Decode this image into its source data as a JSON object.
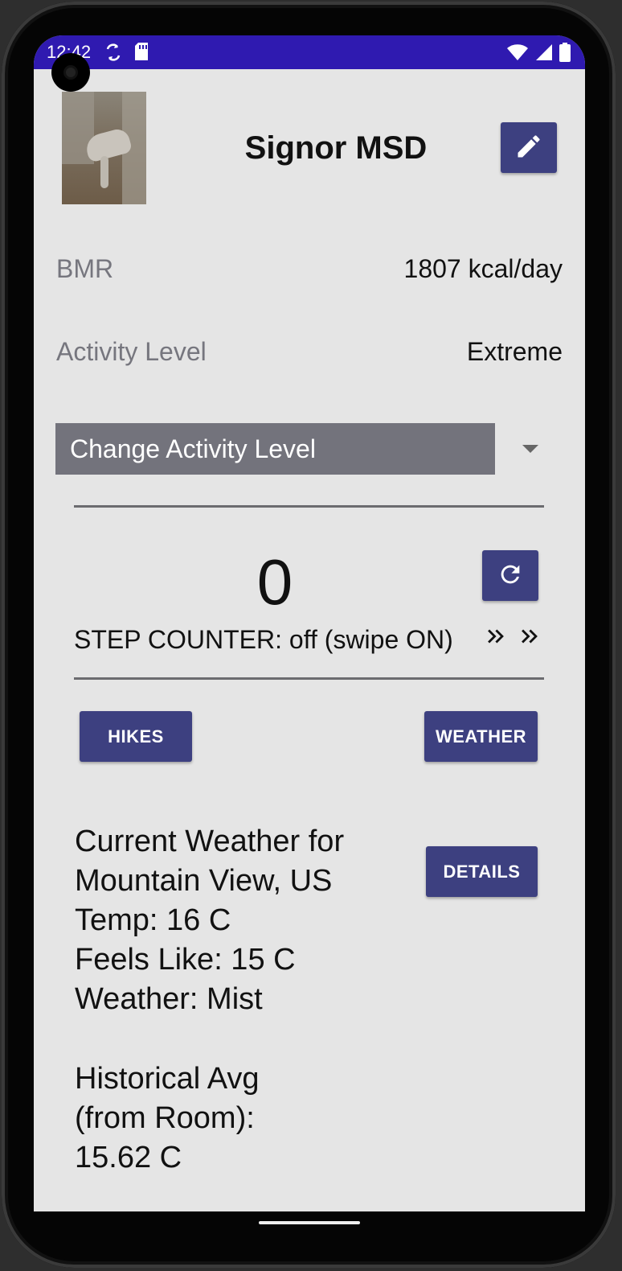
{
  "status_bar": {
    "time": "12:42",
    "left_icons": [
      "sync-icon",
      "sd-card-icon"
    ],
    "right_icons": [
      "wifi-icon",
      "signal-icon",
      "battery-icon"
    ],
    "color": "#2f1ab0"
  },
  "profile": {
    "name": "Signor MSD",
    "edit_icon": "pencil-icon"
  },
  "stats": {
    "bmr_label": "BMR",
    "bmr_value": "1807 kcal/day",
    "activity_label": "Activity Level",
    "activity_value": "Extreme"
  },
  "activity_spinner": {
    "selected": "Change Activity Level"
  },
  "step_counter": {
    "count": "0",
    "label": "STEP COUNTER: off (swipe ON)",
    "reset_icon": "refresh-icon"
  },
  "buttons": {
    "hikes": "HIKES",
    "weather": "WEATHER",
    "details": "DETAILS"
  },
  "weather": {
    "line1": "Current Weather for",
    "line2": "Mountain View, US",
    "temp": "Temp: 16 C",
    "feels_like": "Feels Like: 15 C",
    "condition": "Weather: Mist"
  },
  "historical": {
    "line1": "Historical Avg",
    "line2": "(from Room):",
    "value": "15.62 C"
  },
  "colors": {
    "button": "#3d4080",
    "spinner": "#73737c",
    "background": "#e5e5e5"
  }
}
